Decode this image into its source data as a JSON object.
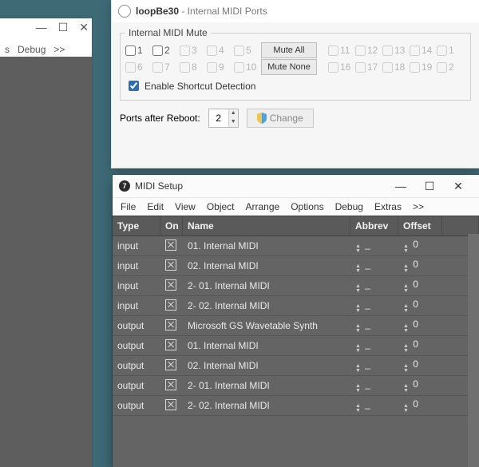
{
  "background_window": {
    "min": "—",
    "max": "☐",
    "close": "✕",
    "menu": [
      "s",
      "Debug",
      ">>"
    ]
  },
  "loopbe": {
    "title_app": "loopBe30",
    "title_rest": " - Internal MIDI Ports",
    "group_title": "Internal MIDI Mute",
    "row1": [
      {
        "n": "1",
        "checked": false,
        "enabled": true
      },
      {
        "n": "2",
        "checked": false,
        "enabled": true
      },
      {
        "n": "3",
        "checked": false,
        "enabled": false
      },
      {
        "n": "4",
        "checked": false,
        "enabled": false
      },
      {
        "n": "5",
        "checked": false,
        "enabled": false
      }
    ],
    "row1b": [
      {
        "n": "11"
      },
      {
        "n": "12"
      },
      {
        "n": "13"
      },
      {
        "n": "14"
      },
      {
        "n": "1"
      }
    ],
    "row2": [
      {
        "n": "6"
      },
      {
        "n": "7"
      },
      {
        "n": "8"
      },
      {
        "n": "9"
      },
      {
        "n": "10"
      }
    ],
    "row2b": [
      {
        "n": "16"
      },
      {
        "n": "17"
      },
      {
        "n": "18"
      },
      {
        "n": "19"
      },
      {
        "n": "2"
      }
    ],
    "mute_all": "Mute All",
    "mute_none": "Mute None",
    "shortcut_label": "Enable Shortcut Detection",
    "shortcut_checked": true,
    "ports_label": "Ports after Reboot:",
    "ports_value": "2",
    "change_label": "Change"
  },
  "midi": {
    "title": "MIDI Setup",
    "win": {
      "min": "—",
      "max": "☐",
      "close": "✕"
    },
    "menu": [
      "File",
      "Edit",
      "View",
      "Object",
      "Arrange",
      "Options",
      "Debug",
      "Extras",
      ">>"
    ],
    "columns": [
      "Type",
      "On",
      "Name",
      "Abbrev",
      "Offset"
    ],
    "rows": [
      {
        "type": "input",
        "on": true,
        "name": "01. Internal MIDI",
        "abbrev": "_",
        "offset": "0"
      },
      {
        "type": "input",
        "on": true,
        "name": "02. Internal MIDI",
        "abbrev": "_",
        "offset": "0"
      },
      {
        "type": "input",
        "on": true,
        "name": "2- 01. Internal MIDI",
        "abbrev": "_",
        "offset": "0"
      },
      {
        "type": "input",
        "on": true,
        "name": "2- 02. Internal MIDI",
        "abbrev": "_",
        "offset": "0"
      },
      {
        "type": "output",
        "on": true,
        "name": "Microsoft GS Wavetable Synth",
        "abbrev": "_",
        "offset": "0"
      },
      {
        "type": "output",
        "on": true,
        "name": "01. Internal MIDI",
        "abbrev": "_",
        "offset": "0"
      },
      {
        "type": "output",
        "on": true,
        "name": "02. Internal MIDI",
        "abbrev": "_",
        "offset": "0"
      },
      {
        "type": "output",
        "on": true,
        "name": "2- 01. Internal MIDI",
        "abbrev": "_",
        "offset": "0"
      },
      {
        "type": "output",
        "on": true,
        "name": "2- 02. Internal MIDI",
        "abbrev": "_",
        "offset": "0"
      }
    ]
  }
}
